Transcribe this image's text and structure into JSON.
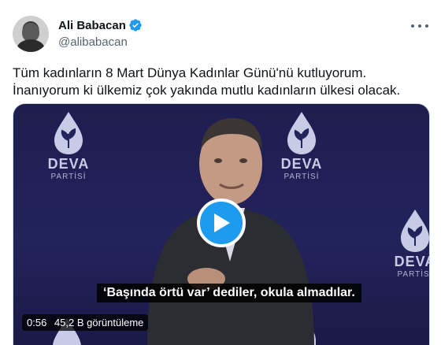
{
  "author": {
    "display_name": "Ali Babacan",
    "handle": "@alibabacan",
    "verified_icon": "verified-badge-icon",
    "avatar": "profile-photo"
  },
  "tweet": {
    "text": "Tüm kadınların 8 Mart Dünya Kadınlar Günü'nü kutluyorum. İnanıyorum ki ülkemiz çok yakında mutlu kadınların ülkesi olacak."
  },
  "video": {
    "logo_word": "DEVA",
    "logo_sub": "PARTİSİ",
    "subtitle": "‘Başında örtü var’ dediler, okula almadılar.",
    "duration": "0:56",
    "views": "45,2 B görüntüleme",
    "play_icon": "play-icon"
  },
  "colors": {
    "accent": "#1d9bf0",
    "text": "#0f1419",
    "secondary": "#536471",
    "video_bg": "#1e1d4f"
  },
  "icons": {
    "more": "more-options-icon"
  }
}
